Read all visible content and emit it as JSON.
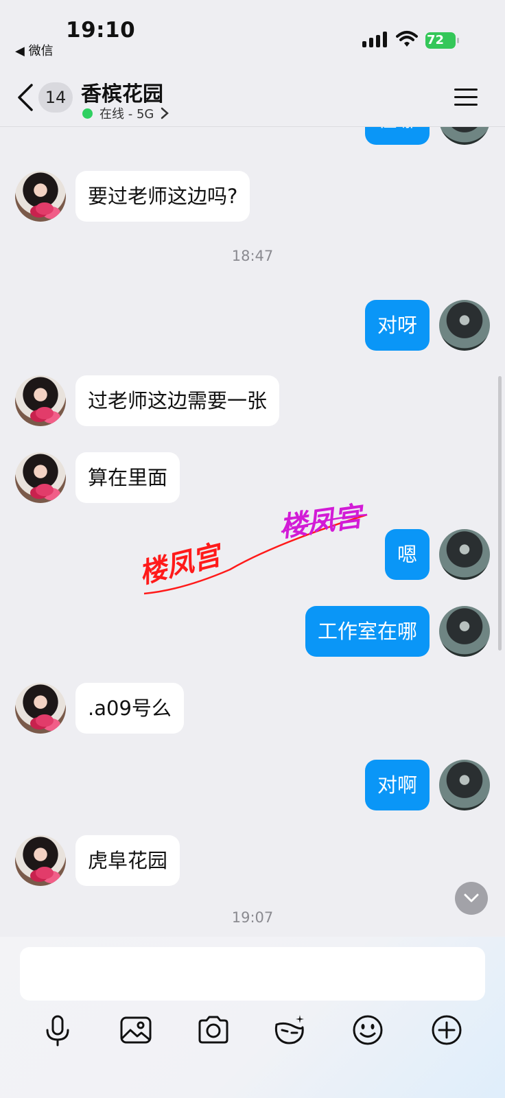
{
  "status_bar": {
    "time": "19:10",
    "back_app": "◀ 微信",
    "battery": "72"
  },
  "header": {
    "unread_count": "14",
    "title": "香槟花园",
    "status": "在线 - 5G"
  },
  "messages": [
    {
      "side": "right",
      "text": "在哪",
      "partial": true
    },
    {
      "side": "left",
      "text": "要过老师这边吗?"
    },
    {
      "type": "time",
      "text": "18:47"
    },
    {
      "side": "right",
      "text": "对呀"
    },
    {
      "side": "left",
      "text": "过老师这边需要一张"
    },
    {
      "side": "left",
      "text": "算在里面"
    },
    {
      "side": "right",
      "text": "嗯"
    },
    {
      "side": "right",
      "text": "工作室在哪"
    },
    {
      "side": "left",
      "text": ".a09号么"
    },
    {
      "side": "right",
      "text": "对啊"
    },
    {
      "side": "left",
      "text": "虎阜花园"
    },
    {
      "type": "time",
      "text": "19:07"
    }
  ],
  "watermark": {
    "text_left": "楼凤宫",
    "text_right": "楼凤宫",
    "color_left": "#ff1a1a",
    "color_right": "#d21bd6"
  },
  "input": {
    "value": "",
    "placeholder": ""
  },
  "toolbar": [
    "microphone-icon",
    "image-icon",
    "camera-icon",
    "red-packet-icon",
    "emoji-icon",
    "plus-icon"
  ],
  "colors": {
    "outgoing_bubble": "#0a96f7",
    "incoming_bubble": "#ffffff",
    "background": "#eeeef2",
    "online": "#2fd061"
  }
}
